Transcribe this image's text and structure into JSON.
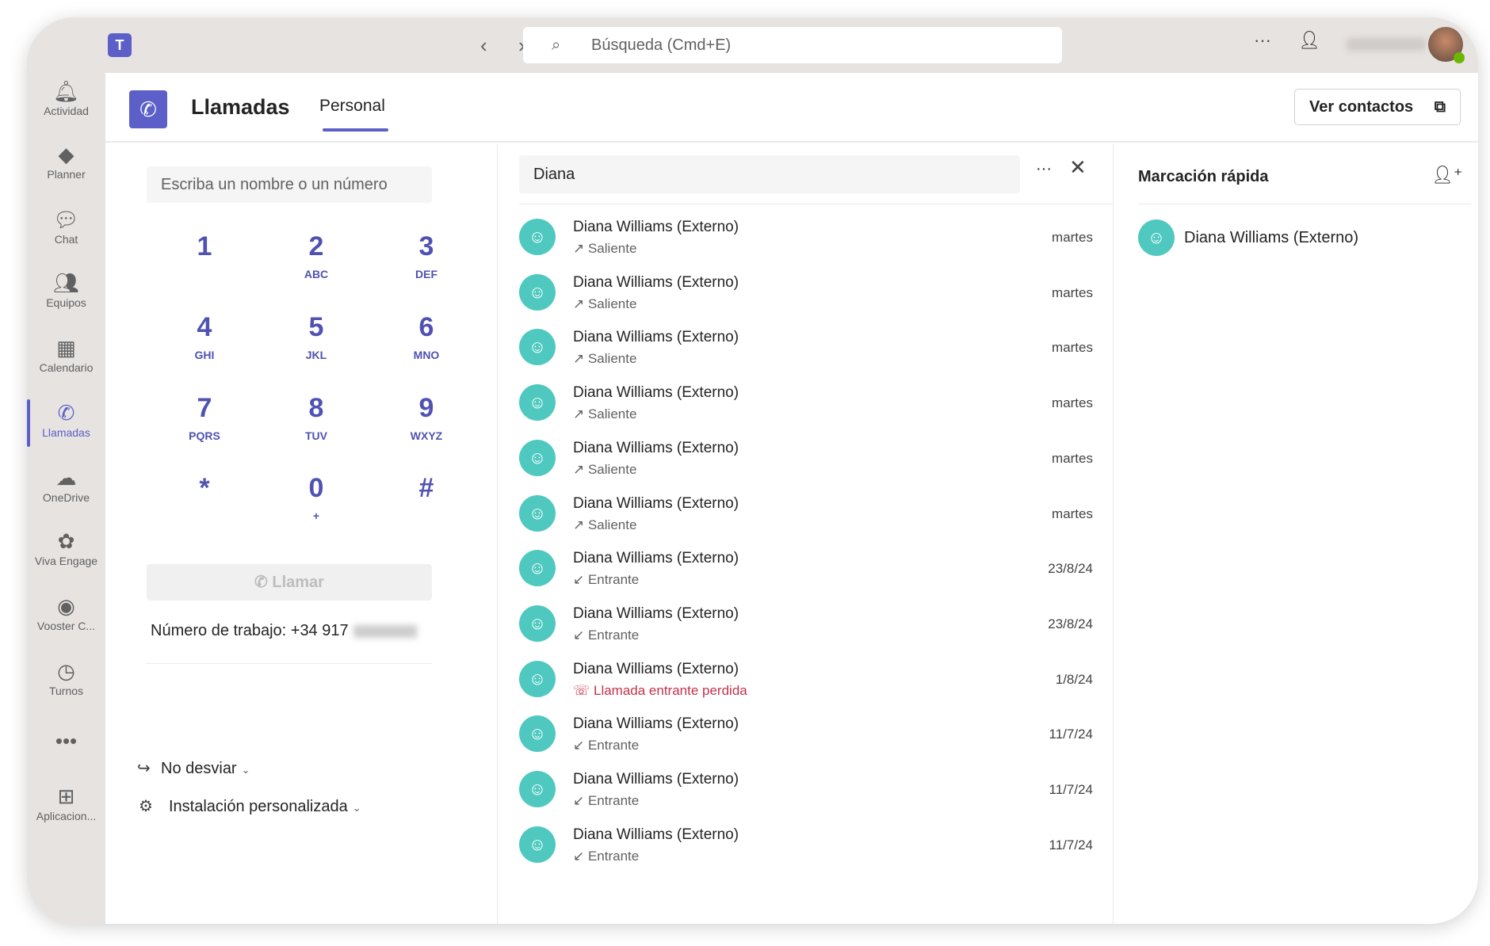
{
  "titlebar": {
    "search_placeholder": "Búsqueda (Cmd+E)",
    "back": "‹",
    "forward": "›",
    "more": "···"
  },
  "sidebar": {
    "items": [
      {
        "label": "Actividad",
        "icon": "bell-icon",
        "glyph": "🔔︎"
      },
      {
        "label": "Planner",
        "icon": "planner-icon",
        "glyph": "◆"
      },
      {
        "label": "Chat",
        "icon": "chat-icon",
        "glyph": "💬︎"
      },
      {
        "label": "Equipos",
        "icon": "teams-icon",
        "glyph": "👥︎"
      },
      {
        "label": "Calendario",
        "icon": "calendar-icon",
        "glyph": "▦"
      },
      {
        "label": "Llamadas",
        "icon": "phone-icon",
        "glyph": "✆",
        "active": true
      },
      {
        "label": "OneDrive",
        "icon": "cloud-icon",
        "glyph": "☁"
      },
      {
        "label": "Viva Engage",
        "icon": "engage-icon",
        "glyph": "✿"
      },
      {
        "label": "Vooster C...",
        "icon": "vooster-icon",
        "glyph": "◉"
      },
      {
        "label": "Turnos",
        "icon": "shifts-icon",
        "glyph": "◷"
      },
      {
        "label": "",
        "icon": "more-icon",
        "glyph": "•••"
      },
      {
        "label": "Aplicacion...",
        "icon": "add-app-icon",
        "glyph": "⊞"
      }
    ]
  },
  "header": {
    "title": "Llamadas",
    "tab": "Personal",
    "contacts_button": "Ver contactos"
  },
  "dialpad": {
    "input_placeholder": "Escriba un nombre o un número",
    "keys": [
      {
        "d": "1",
        "l": ""
      },
      {
        "d": "2",
        "l": "ABC"
      },
      {
        "d": "3",
        "l": "DEF"
      },
      {
        "d": "4",
        "l": "GHI"
      },
      {
        "d": "5",
        "l": "JKL"
      },
      {
        "d": "6",
        "l": "MNO"
      },
      {
        "d": "7",
        "l": "PQRS"
      },
      {
        "d": "8",
        "l": "TUV"
      },
      {
        "d": "9",
        "l": "WXYZ"
      },
      {
        "d": "*",
        "l": ""
      },
      {
        "d": "0",
        "l": "+"
      },
      {
        "d": "#",
        "l": ""
      }
    ],
    "call_button": "Llamar",
    "work_number": "Número de trabajo: +34 917",
    "forwarding": "No desviar",
    "setup": "Instalación personalizada"
  },
  "history": {
    "filter_value": "Diana",
    "rows": [
      {
        "name": "Diana Williams (Externo)",
        "status": "Saliente",
        "type": "outgoing",
        "date": "martes"
      },
      {
        "name": "Diana Williams (Externo)",
        "status": "Saliente",
        "type": "outgoing",
        "date": "martes"
      },
      {
        "name": "Diana Williams (Externo)",
        "status": "Saliente",
        "type": "outgoing",
        "date": "martes"
      },
      {
        "name": "Diana Williams (Externo)",
        "status": "Saliente",
        "type": "outgoing",
        "date": "martes"
      },
      {
        "name": "Diana Williams (Externo)",
        "status": "Saliente",
        "type": "outgoing",
        "date": "martes"
      },
      {
        "name": "Diana Williams (Externo)",
        "status": "Saliente",
        "type": "outgoing",
        "date": "martes"
      },
      {
        "name": "Diana Williams (Externo)",
        "status": "Entrante",
        "type": "incoming",
        "date": "23/8/24"
      },
      {
        "name": "Diana Williams (Externo)",
        "status": "Entrante",
        "type": "incoming",
        "date": "23/8/24"
      },
      {
        "name": "Diana Williams (Externo)",
        "status": "Llamada entrante perdida",
        "type": "missed",
        "date": "1/8/24"
      },
      {
        "name": "Diana Williams (Externo)",
        "status": "Entrante",
        "type": "incoming",
        "date": "11/7/24"
      },
      {
        "name": "Diana Williams (Externo)",
        "status": "Entrante",
        "type": "incoming",
        "date": "11/7/24"
      },
      {
        "name": "Diana Williams (Externo)",
        "status": "Entrante",
        "type": "incoming",
        "date": "11/7/24"
      }
    ]
  },
  "speed_dial": {
    "title": "Marcación rápida",
    "contacts": [
      {
        "name": "Diana Williams (Externo)"
      }
    ]
  },
  "colors": {
    "accent": "#5b5fc7",
    "avatar": "#4fc9c0",
    "missed": "#c4314b"
  }
}
